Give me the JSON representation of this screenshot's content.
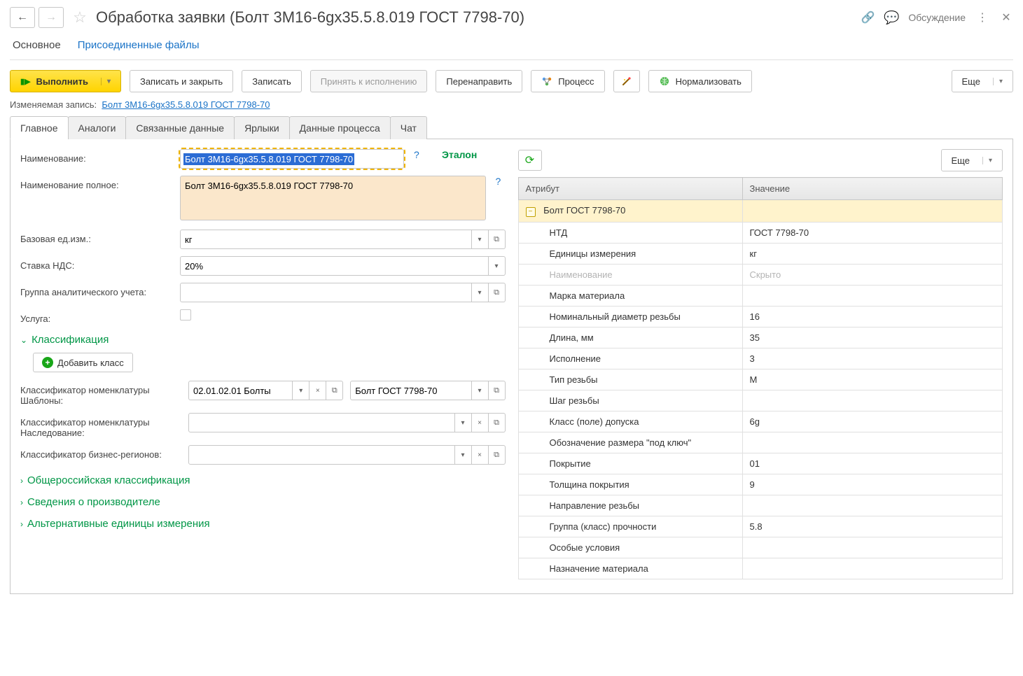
{
  "titlebar": {
    "title": "Обработка заявки (Болт 3М16-6gx35.5.8.019 ГОСТ 7798-70)",
    "discuss": "Обсуждение"
  },
  "sections": {
    "main": "Основное",
    "files": "Присоединенные файлы"
  },
  "toolbar": {
    "execute": "Выполнить",
    "save_close": "Записать и закрыть",
    "save": "Записать",
    "accept": "Принять к исполнению",
    "redirect": "Перенаправить",
    "process": "Процесс",
    "normalize": "Нормализовать",
    "more": "Еще"
  },
  "record": {
    "label": "Изменяемая запись:",
    "link": "Болт 3М16-6gx35.5.8.019 ГОСТ 7798-70"
  },
  "tabs": [
    "Главное",
    "Аналоги",
    "Связанные данные",
    "Ярлыки",
    "Данные процесса",
    "Чат"
  ],
  "fields": {
    "name_label": "Наименование:",
    "name_value": "Болт 3М16-6gx35.5.8.019 ГОСТ 7798-70",
    "etalon": "Эталон",
    "full_name_label": "Наименование полное:",
    "full_name_value": "Болт 3М16-6gx35.5.8.019 ГОСТ 7798-70",
    "base_uom_label": "Базовая ед.изм.:",
    "base_uom_value": "кг",
    "vat_label": "Ставка НДС:",
    "vat_value": "20%",
    "acct_group_label": "Группа аналитического учета:",
    "acct_group_value": "",
    "service_label": "Услуга:"
  },
  "classification": {
    "header": "Классификация",
    "add_class": "Добавить класс",
    "tpl_label": "Классификатор номенклатуры Шаблоны:",
    "tpl_class": "02.01.02.01 Болты",
    "tpl_sub": "Болт ГОСТ 7798-70",
    "inh_label": "Классификатор номенклатуры Наследование:",
    "biz_label": "Классификатор бизнес-регионов:"
  },
  "groups": {
    "okp": "Общероссийская классификация",
    "producer": "Сведения о производителе",
    "alt_uom": "Альтернативные единицы измерения"
  },
  "right": {
    "more": "Еще",
    "col_attr": "Атрибут",
    "col_val": "Значение",
    "root": "Болт ГОСТ 7798-70",
    "rows": [
      {
        "n": "НТД",
        "v": "ГОСТ 7798-70"
      },
      {
        "n": "Единицы измерения",
        "v": "кг"
      },
      {
        "n": "Наименование",
        "v": "Скрыто",
        "disabled": true
      },
      {
        "n": "Марка материала",
        "v": ""
      },
      {
        "n": "Номинальный диаметр резьбы",
        "v": "16"
      },
      {
        "n": "Длина, мм",
        "v": "35"
      },
      {
        "n": "Исполнение",
        "v": "3"
      },
      {
        "n": "Тип резьбы",
        "v": "М"
      },
      {
        "n": "Шаг резьбы",
        "v": ""
      },
      {
        "n": "Класс (поле) допуска",
        "v": "6g"
      },
      {
        "n": "Обозначение размера \"под ключ\"",
        "v": ""
      },
      {
        "n": "Покрытие",
        "v": "01"
      },
      {
        "n": "Толщина покрытия",
        "v": "9"
      },
      {
        "n": "Направление резьбы",
        "v": ""
      },
      {
        "n": "Группа (класс) прочности",
        "v": "5.8"
      },
      {
        "n": "Особые условия",
        "v": ""
      },
      {
        "n": "Назначение материала",
        "v": ""
      }
    ]
  }
}
